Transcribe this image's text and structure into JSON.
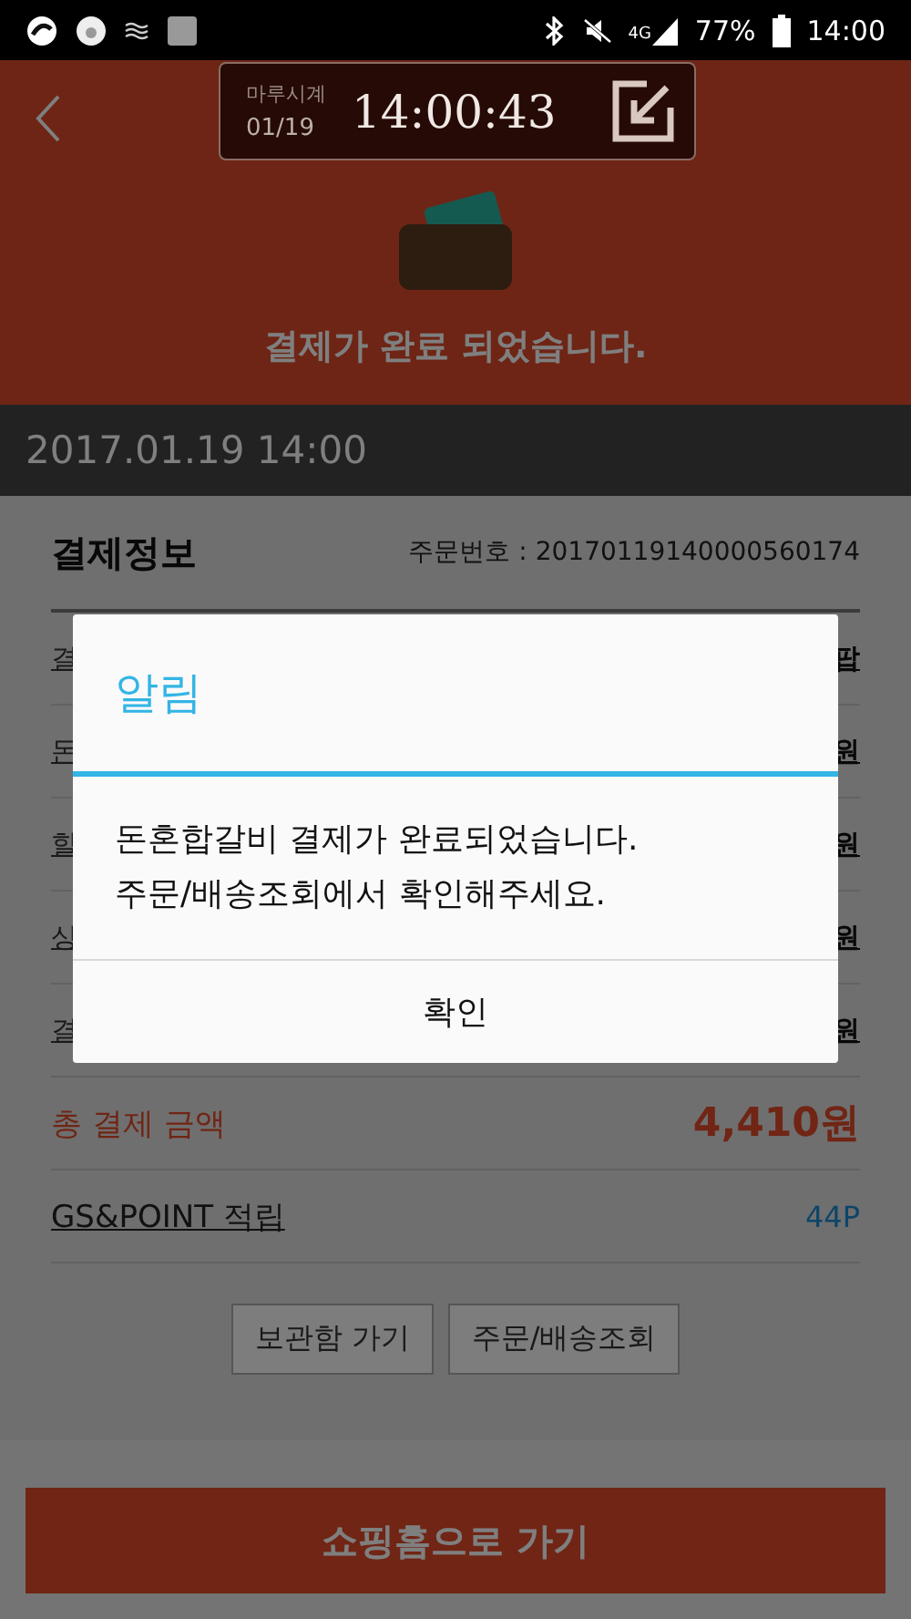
{
  "status_bar": {
    "network": "4G",
    "battery": "77%",
    "time": "14:00"
  },
  "header": {
    "message": "결제가 완료 되었습니다."
  },
  "clock_widget": {
    "name": "마루시계",
    "date": "01/19",
    "time": "14:00:43"
  },
  "date_bar": {
    "text": "2017.01.19 14:00"
  },
  "payment_info": {
    "title": "결제정보",
    "order_number": "주문번호 : 20170119140000560174",
    "rows": [
      {
        "label": "결",
        "value": "팝"
      },
      {
        "label": "돈",
        "value": "원"
      },
      {
        "label": "할",
        "value": "원"
      },
      {
        "label": "상",
        "value": "원"
      },
      {
        "label": "결",
        "value": "원"
      }
    ],
    "total": {
      "label": "총 결제 금액",
      "value": "4,410원"
    },
    "points": {
      "label": "GS&POINT 적립",
      "value": "44P"
    },
    "buttons": [
      "보관함 가기",
      "주문/배송조회"
    ]
  },
  "bottom_button": "쇼핑홈으로 가기",
  "dialog": {
    "title": "알림",
    "message": [
      "돈혼합갈비 결제가 완료되었습니다.",
      "주문/배송조회에서 확인해주세요."
    ],
    "button": "확인"
  }
}
